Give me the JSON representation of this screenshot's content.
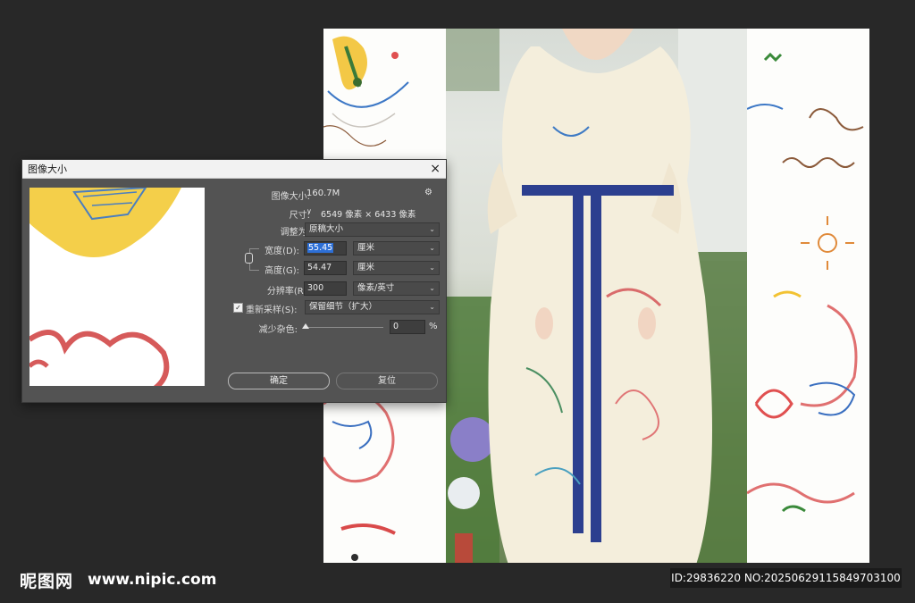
{
  "dialog": {
    "title": "图像大小",
    "image_size_label": "图像大小:",
    "image_size_value": "160.7M",
    "dimensions_label": "尺寸:",
    "dimensions_chevron": "∨",
    "dimensions_value": "6549 像素 × 6433 像素",
    "fit_to_label": "调整为:",
    "fit_to_value": "原稿大小",
    "width_label": "宽度(D):",
    "width_value": "55.45",
    "width_unit": "厘米",
    "height_label": "高度(G):",
    "height_value": "54.47",
    "height_unit": "厘米",
    "resolution_label": "分辨率(R):",
    "resolution_value": "300",
    "resolution_unit": "像素/英寸",
    "resample_label": "重新采样(S):",
    "resample_checked": true,
    "resample_value": "保留细节（扩大）",
    "noise_label": "减少杂色:",
    "noise_value": "0",
    "noise_unit": "%",
    "ok_label": "确定",
    "reset_label": "复位",
    "close_icon": "×",
    "gear_icon": "⚙"
  },
  "watermark": {
    "brand": "昵图网",
    "site": "www.nipic.com",
    "id_text": "ID:29836220 NO:20250629115849703100"
  },
  "colors": {
    "app_background": "#282828",
    "dialog_background": "#535353",
    "title_bar": "#f2f2f2",
    "selection": "#2d6fd6",
    "belt_blue": "#2c3f8f"
  }
}
